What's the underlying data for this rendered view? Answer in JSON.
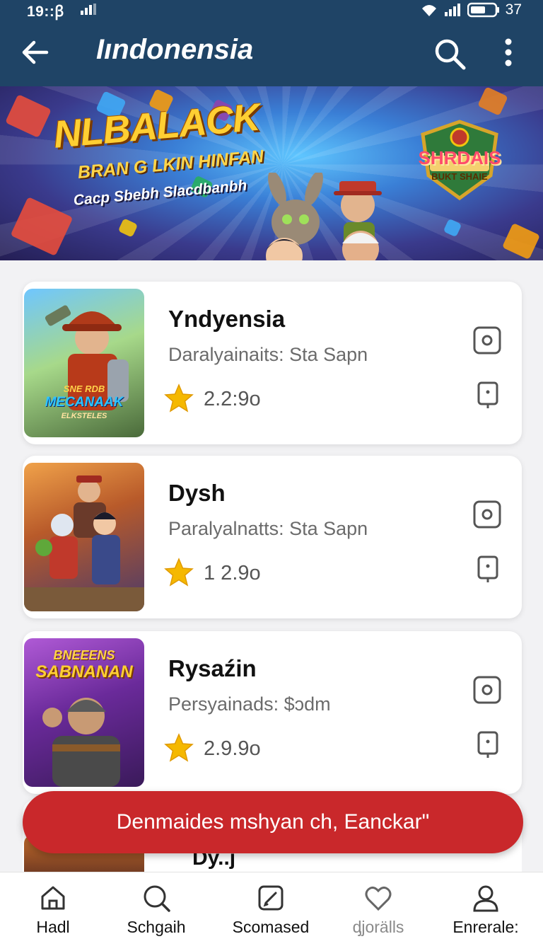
{
  "status_bar": {
    "time": "19::ꞵ",
    "battery": "37"
  },
  "app_bar": {
    "title": "Iındonensia",
    "icons": [
      "back-arrow-icon",
      "search-icon",
      "more-vert-icon"
    ]
  },
  "banner": {
    "title": "NLBALACK",
    "subtitle": "BRAN G LKIN HINFAN",
    "tagline": "Cacp Sbebh Slacdbanbh",
    "badge_title": "SHRDAIS",
    "badge_subtitle": "BUKT SHAIE"
  },
  "games": [
    {
      "name": "Yndyensia",
      "subtitle": "Daralyainaits: Sta Sapn",
      "rating": "2.2:9o",
      "thumb_text": "SNE RDB",
      "thumb_text2": "MECANAAK",
      "thumb_text3": "ELKSTELES"
    },
    {
      "name": "Dysh",
      "subtitle": "Paralyalnatts: Sta Sapn",
      "rating": "1 2.9o"
    },
    {
      "name": "Rysaźin",
      "subtitle": "Persyainads: $ɔdm",
      "rating": "2.9.9o",
      "thumb_text": "BNEEENS",
      "thumb_text2": "SABNANAN"
    },
    {
      "name": "Dy..j"
    }
  ],
  "toast": {
    "text": "Denmaides mshyan ch, Eanckar\""
  },
  "bottom_nav": [
    {
      "label": "Hadl",
      "icon": "home-icon"
    },
    {
      "label": "Schgaih",
      "icon": "search-icon"
    },
    {
      "label": "Scomased",
      "icon": "edit-icon"
    },
    {
      "label": "ᶁjorälls",
      "icon": "heart-icon"
    },
    {
      "label": "Enrerale:",
      "icon": "profile-icon"
    }
  ],
  "colors": {
    "app_bar": "#1f4466",
    "toast": "#c9282b",
    "star": "#f5b800"
  }
}
